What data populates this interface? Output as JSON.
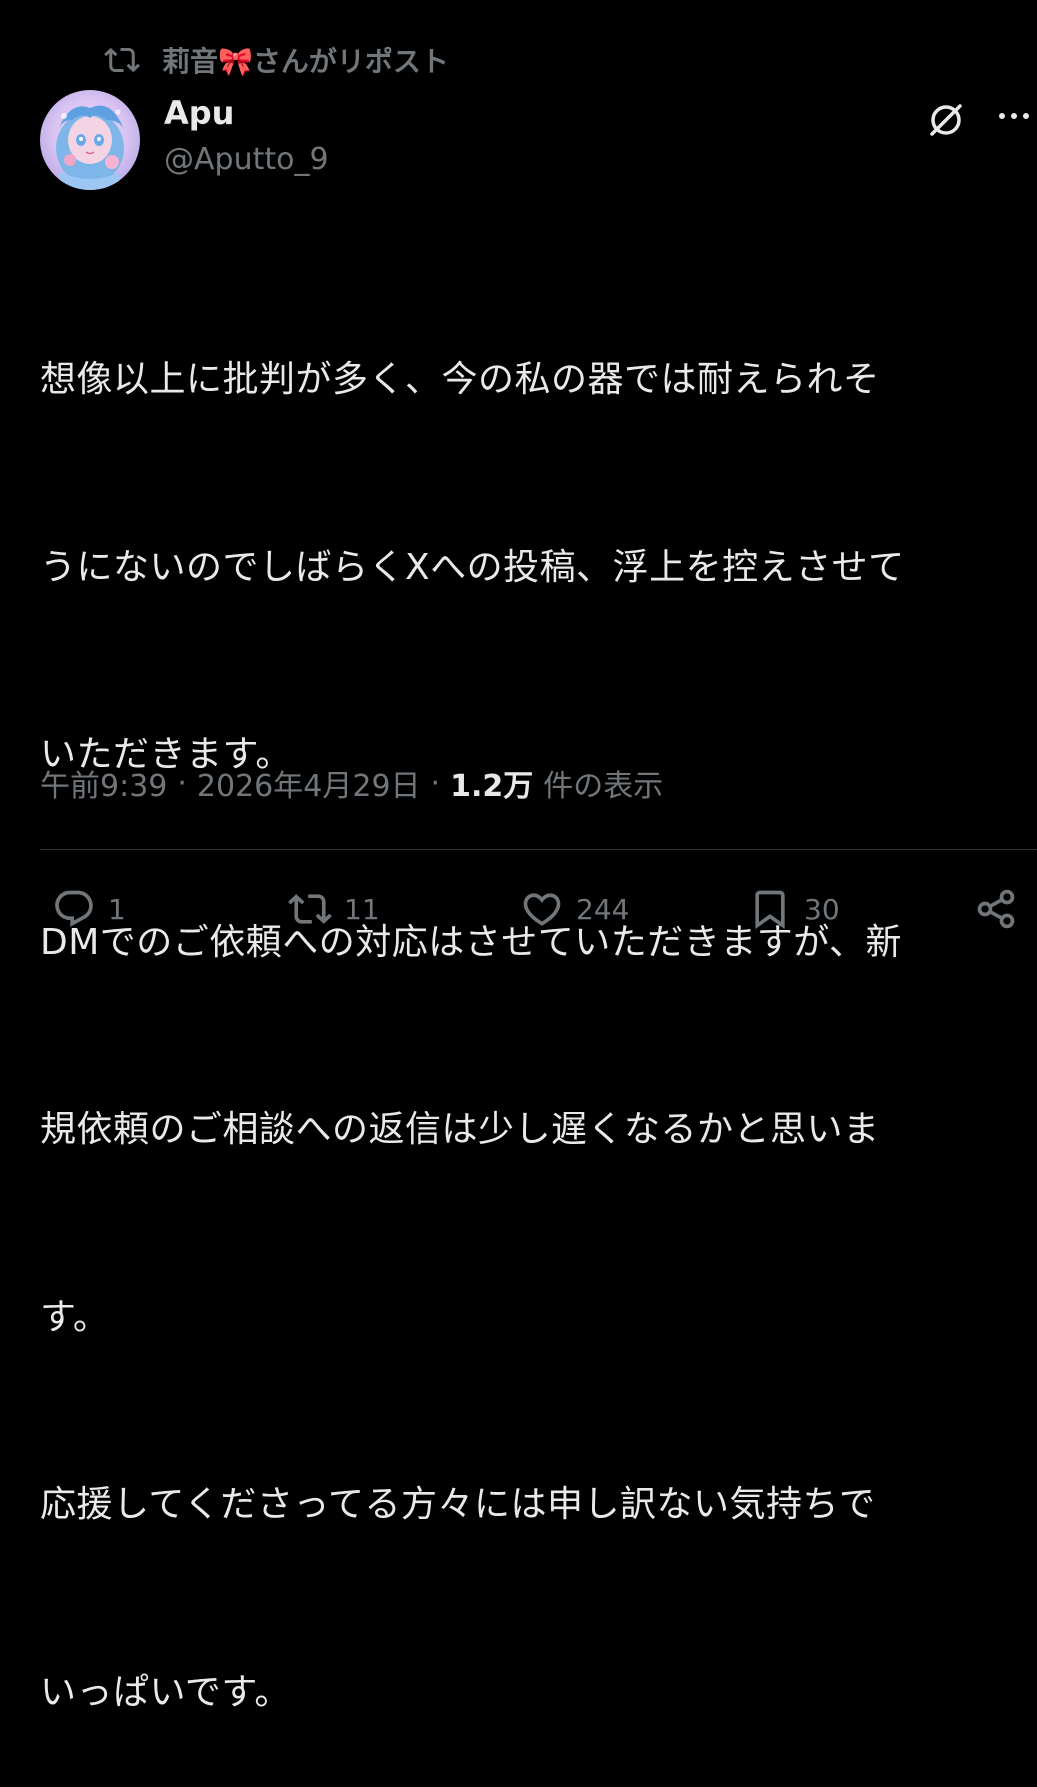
{
  "repost": {
    "text": "莉音🎀さんがリポスト",
    "icon": "repost-icon"
  },
  "author": {
    "display_name": "Apu",
    "handle": "@Aputto_9",
    "avatar": "avatar-image"
  },
  "header_icons": {
    "grok": "grok-icon",
    "more": "more-icon"
  },
  "tweet": {
    "lines": [
      "想像以上に批判が多く、今の私の器では耐えられそ",
      "うにないのでしばらくXへの投稿、浮上を控えさせて",
      "いただきます。",
      "DMでのご依頼への対応はさせていただきますが、新",
      "規依頼のご相談への返信は少し遅くなるかと思いま",
      "す。",
      "応援してくださってる方々には申し訳ない気持ちで",
      "いっぱいです。"
    ]
  },
  "meta": {
    "time": "午前9:39",
    "separator": "·",
    "date": "2026年4月29日",
    "views_count": "1.2万",
    "views_label": "件の表示"
  },
  "actions": {
    "reply_count": "1",
    "repost_count": "11",
    "like_count": "244",
    "bookmark_count": "30"
  },
  "colors": {
    "background": "#000000",
    "text_primary": "#e7e9ea",
    "text_secondary": "#71767b",
    "divider": "#2f3336"
  }
}
